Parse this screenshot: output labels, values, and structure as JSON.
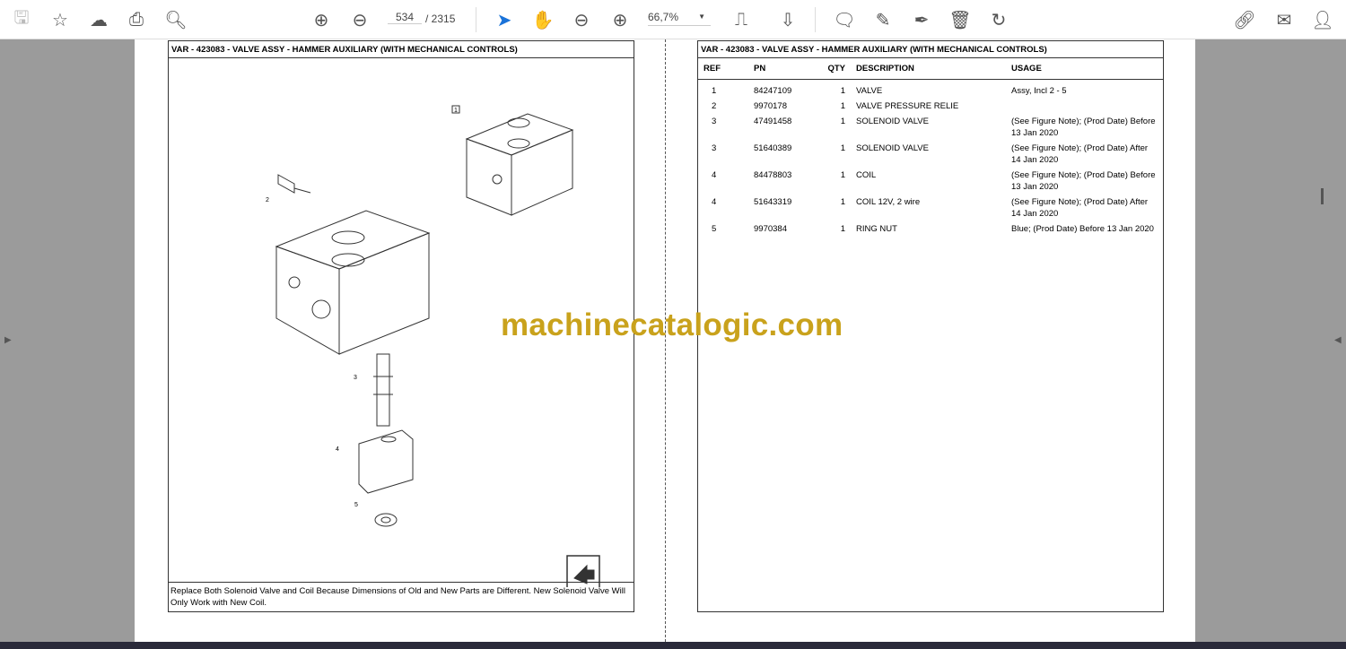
{
  "toolbar": {
    "page_current": "534",
    "page_total": "/ 2315",
    "zoom": "66,7%"
  },
  "icons": [
    "save-icon",
    "star-icon",
    "upload-icon",
    "print-icon",
    "search-icon",
    "page-up-icon",
    "page-down-icon",
    "select-cursor-icon",
    "hand-icon",
    "zoom-out-icon",
    "zoom-in-icon",
    "fit-page-icon",
    "scroll-mode-icon",
    "comment-icon",
    "highlight-icon",
    "sign-icon",
    "delete-icon",
    "rotate-icon",
    "share-link-icon",
    "email-icon",
    "add-user-icon"
  ],
  "left_page": {
    "title": "VAR - 423083 - VALVE ASSY - HAMMER AUXILIARY (WITH MECHANICAL CONTROLS)",
    "callouts": [
      "1",
      "2",
      "3",
      "4",
      "5"
    ],
    "note": "Replace Both Solenoid Valve and Coil Because Dimensions of Old and New Parts are Different. New Solenoid Valve Will Only Work with New Coil."
  },
  "right_page": {
    "title": "VAR - 423083 - VALVE ASSY - HAMMER AUXILIARY (WITH MECHANICAL CONTROLS)",
    "headers": [
      "REF",
      "PN",
      "QTY",
      "DESCRIPTION",
      "USAGE"
    ],
    "rows": [
      [
        "1",
        "84247109",
        "1",
        "VALVE",
        "Assy, Incl 2 - 5"
      ],
      [
        "2",
        "9970178",
        "1",
        "VALVE PRESSURE RELIE",
        ""
      ],
      [
        "3",
        "47491458",
        "1",
        "SOLENOID VALVE",
        "(See Figure Note); (Prod Date) Before 13 Jan 2020"
      ],
      [
        "3",
        "51640389",
        "1",
        "SOLENOID VALVE",
        "(See Figure Note); (Prod Date) After 14 Jan 2020"
      ],
      [
        "4",
        "84478803",
        "1",
        "COIL",
        "(See Figure Note); (Prod Date) Before 13 Jan 2020"
      ],
      [
        "4",
        "51643319",
        "1",
        "COIL 12V, 2 wire",
        "(See Figure Note); (Prod Date) After 14 Jan 2020"
      ],
      [
        "5",
        "9970384",
        "1",
        "RING NUT",
        "Blue; (Prod Date) Before 13 Jan 2020"
      ]
    ]
  },
  "watermark": "machinecatalogic.com"
}
